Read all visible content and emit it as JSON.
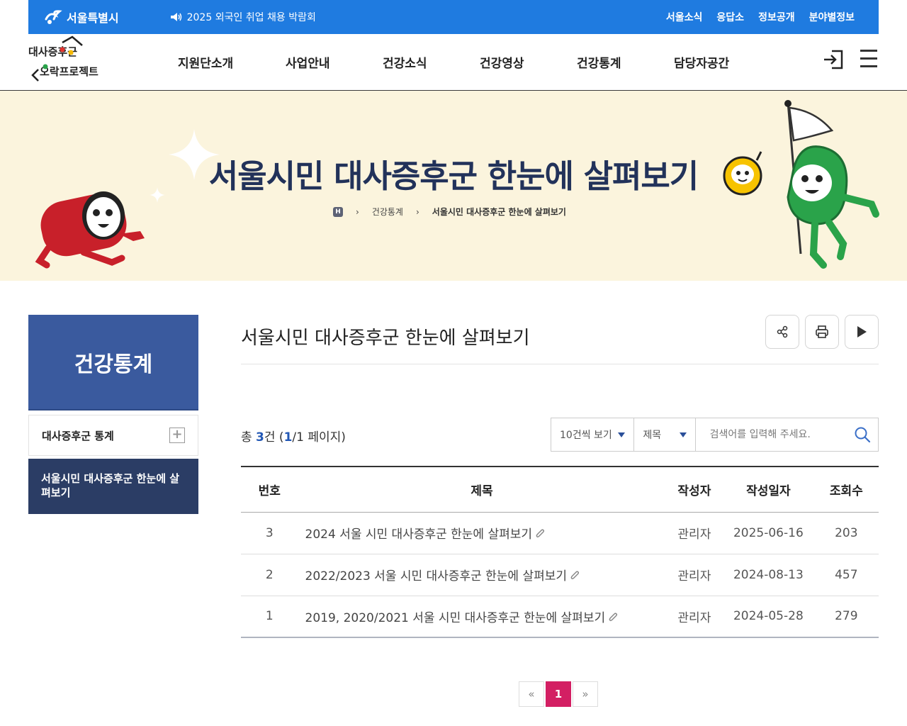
{
  "topbar": {
    "brand": "서울특별시",
    "notice": "2025 외국인 취업 채용 박람회",
    "links": [
      "서울소식",
      "응답소",
      "정보공개",
      "분야별정보"
    ]
  },
  "gnb": {
    "logo_label": "대사증후군 오락프로젝트",
    "menu": [
      "지원단소개",
      "사업안내",
      "건강소식",
      "건강영상",
      "건강통계",
      "담당자공간"
    ]
  },
  "visual": {
    "title": "서울시민 대사증후군 한눈에 살펴보기",
    "breadcrumb": [
      "건강통계",
      "서울시민 대사증후군 한눈에 살펴보기"
    ]
  },
  "lnb": {
    "heading": "건강통계",
    "items": [
      "대사증후군 통계"
    ],
    "active": "서울시민 대사증후군 한눈에 살펴보기"
  },
  "content": {
    "title": "서울시민 대사증후군 한눈에 살펴보기",
    "total_prefix": "총 ",
    "total_count": "3",
    "total_mid": "건 (",
    "page_current": "1",
    "page_total": "/1 페이지)",
    "page_size_option": "10건씩 보기",
    "search_field_option": "제목",
    "search_placeholder": "검색어를 입력해 주세요.",
    "columns": [
      "번호",
      "제목",
      "작성자",
      "작성일자",
      "조회수"
    ],
    "rows": [
      {
        "no": "3",
        "subject": "2024 서울 시민 대사증후군 한눈에 살펴보기",
        "author": "관리자",
        "date": "2025-06-16",
        "views": "203"
      },
      {
        "no": "2",
        "subject": "2022/2023 서울 시민 대사증후군 한눈에 살펴보기",
        "author": "관리자",
        "date": "2024-08-13",
        "views": "457"
      },
      {
        "no": "1",
        "subject": "2019, 2020/2021 서울 시민 대사증후군 한눈에 살펴보기",
        "author": "관리자",
        "date": "2024-05-28",
        "views": "279"
      }
    ],
    "pagination": {
      "current": "1",
      "prev": "«",
      "next": "»"
    }
  },
  "colors": {
    "topbar": "#1f7be0",
    "lnb_head": "#3a5a9e",
    "lnb_active": "#2b3d65",
    "visual_bg": "#fbf4dd",
    "page_active": "#d31f63"
  }
}
